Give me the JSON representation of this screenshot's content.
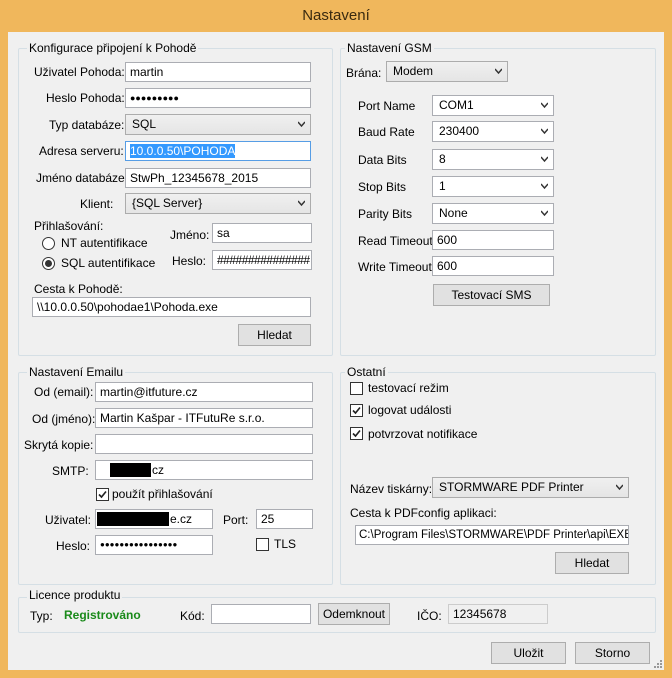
{
  "window": {
    "title": "Nastavení"
  },
  "pohoda": {
    "title": "Konfigurace připojení k Pohodě",
    "user_label": "Uživatel Pohoda:",
    "user_value": "martin",
    "password_label": "Heslo Pohoda:",
    "password_value": "●●●●●●●●●",
    "dbtype_label": "Typ databáze:",
    "dbtype_value": "SQL",
    "server_label": "Adresa serveru:",
    "server_value": "10.0.0.50\\POHODA",
    "dbname_label": "Jméno databáze:",
    "dbname_value": "StwPh_12345678_2015",
    "client_label": "Klient:",
    "client_value": "{SQL Server}",
    "login_label": "Přihlašování:",
    "nt_auth_label": "NT autentifikace",
    "sql_auth_label": "SQL autentifikace",
    "name_label": "Jméno:",
    "name_value": "sa",
    "heslo_label": "Heslo:",
    "heslo_value": "###############",
    "path_label": "Cesta k Pohodě:",
    "path_value": "\\\\10.0.0.50\\pohodae1\\Pohoda.exe",
    "search_label": "Hledat"
  },
  "gsm": {
    "title": "Nastavení GSM",
    "gateway_label": "Brána:",
    "gateway_value": "Modem",
    "port_label": "Port Name",
    "port_value": "COM1",
    "baud_label": "Baud Rate",
    "baud_value": "230400",
    "databits_label": "Data Bits",
    "databits_value": "8",
    "stopbits_label": "Stop Bits",
    "stopbits_value": "1",
    "parity_label": "Parity Bits",
    "parity_value": "None",
    "read_timeout_label": "Read Timeout",
    "read_timeout_value": "600",
    "write_timeout_label": "Write Timeout",
    "write_timeout_value": "600",
    "test_sms_label": "Testovací SMS"
  },
  "email": {
    "title": "Nastavení Emailu",
    "from_email_label": "Od (email):",
    "from_email_value": "martin@itfuture.cz",
    "from_name_label": "Od (jméno):",
    "from_name_value": "Martin Kašpar - ITFutuRe s.r.o.",
    "bcc_label": "Skrytá kopie:",
    "bcc_value": "",
    "smtp_label": "SMTP:",
    "smtp_value_suffix": "cz",
    "use_login_label": "použít přihlašování",
    "user_label": "Uživatel:",
    "user_value_suffix": "e.cz",
    "port_label": "Port:",
    "port_value": "25",
    "password_label": "Heslo:",
    "password_value": "●●●●●●●●●●●●●●●●",
    "tls_label": "TLS"
  },
  "other": {
    "title": "Ostatní",
    "test_mode_label": "testovací režim",
    "log_events_label": "logovat události",
    "confirm_notifications_label": "potvrzovat notifikace",
    "printer_label": "Název tiskárny:",
    "printer_value": "STORMWARE PDF Printer",
    "pdfconfig_label": "Cesta k PDFconfig aplikaci:",
    "pdfconfig_value": "C:\\Program Files\\STORMWARE\\PDF Printer\\api\\EXEv",
    "search_label": "Hledat"
  },
  "license": {
    "title": "Licence produktu",
    "type_label": "Typ:",
    "type_value": "Registrováno",
    "code_label": "Kód:",
    "code_value": "",
    "unlock_label": "Odemknout",
    "ico_label": "IČO:",
    "ico_value": "12345678"
  },
  "footer": {
    "save_label": "Uložit",
    "cancel_label": "Storno"
  },
  "colors": {
    "title_bar": "#f0b75c",
    "client_bg": "#f0f0f0",
    "registered": "#1a8a1a",
    "selection": "#3399ff"
  }
}
